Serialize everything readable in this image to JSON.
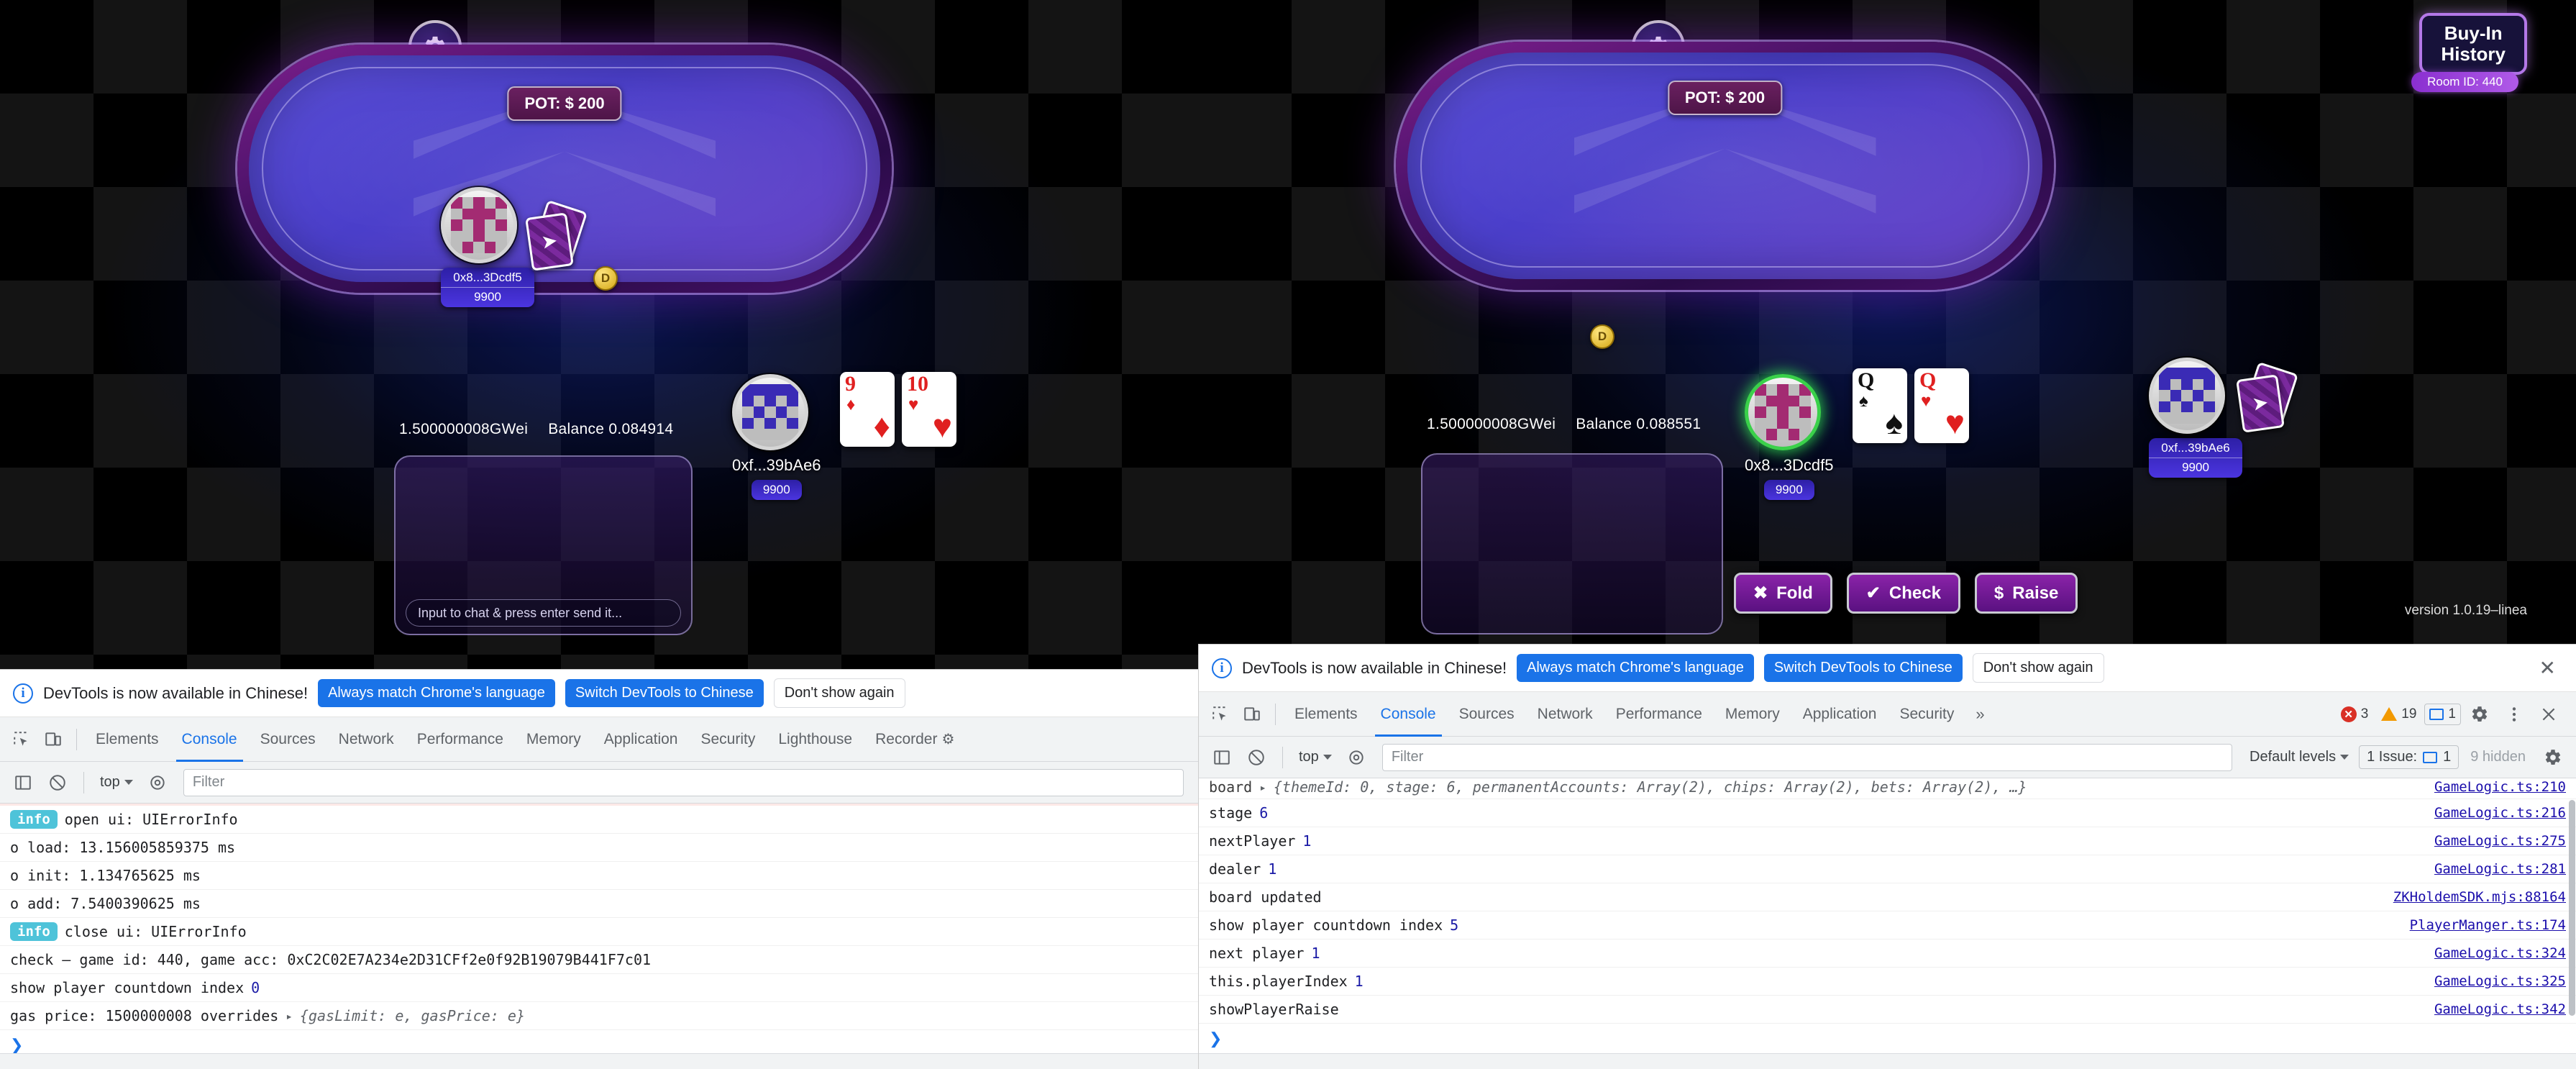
{
  "game_left": {
    "gear_icon": "gear-icon",
    "pot_label": "POT: $ 200",
    "gas_price": "1.500000008GWei",
    "balance": "Balance 0.084914",
    "chat_placeholder": "Input to chat & press enter send it...",
    "players": [
      {
        "id": "top-left",
        "name": "0x8...3Dcdf5",
        "chips": "9900",
        "cards_hidden": true,
        "active": false
      },
      {
        "id": "bottom",
        "name": "0xf...39bAe6",
        "chips": "9900",
        "cards_hidden": false,
        "active": false,
        "cards": [
          {
            "rank": "9",
            "suit": "♦",
            "color": "red"
          },
          {
            "rank": "10",
            "suit": "♥",
            "color": "red"
          }
        ]
      }
    ],
    "dealer_button": "D"
  },
  "game_right": {
    "gear_icon": "gear-icon",
    "pot_label": "POT: $ 200",
    "gas_price": "1.500000008GWei",
    "balance": "Balance 0.088551",
    "buyin_button": "Buy-In\nHistory",
    "buyin_line1": "Buy-In",
    "buyin_line2": "History",
    "room_id": "Room ID: 440",
    "version": "version 1.0.19–linea",
    "players": [
      {
        "id": "right-side",
        "name": "0xf...39bAe6",
        "chips": "9900",
        "cards_hidden": true,
        "active": false
      },
      {
        "id": "bottom",
        "name": "0x8...3Dcdf5",
        "chips": "9900",
        "cards_hidden": false,
        "active": true,
        "cards": [
          {
            "rank": "Q",
            "suit": "♠",
            "color": "black"
          },
          {
            "rank": "Q",
            "suit": "♥",
            "color": "red"
          }
        ]
      }
    ],
    "dealer_button": "D",
    "actions": [
      {
        "icon": "✖",
        "label": "Fold",
        "name": "fold-button"
      },
      {
        "icon": "✔",
        "label": "Check",
        "name": "check-button"
      },
      {
        "icon": "$",
        "label": "Raise",
        "name": "raise-button"
      }
    ]
  },
  "devtools_left": {
    "banner": {
      "message": "DevTools is now available in Chinese!",
      "btn_always": "Always match Chrome's language",
      "btn_switch": "Switch DevTools to Chinese",
      "btn_dismiss": "Don't show again"
    },
    "tabs": [
      "Elements",
      "Console",
      "Sources",
      "Network",
      "Performance",
      "Memory",
      "Application",
      "Security",
      "Lighthouse",
      "Recorder"
    ],
    "active_tab": "Console",
    "toolbar": {
      "context": "top",
      "filter_placeholder": "Filter"
    },
    "logs": [
      {
        "type": "info",
        "badge": "info",
        "text": "open ui: UIErrorInfo",
        "source": ""
      },
      {
        "type": "plain",
        "text": "o load: 13.156005859375 ms",
        "source": ""
      },
      {
        "type": "plain",
        "text": "o init: 1.134765625 ms",
        "source": ""
      },
      {
        "type": "plain",
        "text": "o add: 7.5400390625 ms",
        "source": ""
      },
      {
        "type": "info",
        "badge": "info",
        "text": "close ui: UIErrorInfo",
        "source": ""
      },
      {
        "type": "plain",
        "text": "check — game id: 440, game acc: 0xC2C02E7A234e2D31CFf2e0f92B19079B441F7c01",
        "source": ""
      },
      {
        "type": "num",
        "text": "show player countdown index ",
        "value": "0",
        "source": ""
      },
      {
        "type": "obj",
        "text": "gas price: 1500000008 overrides ",
        "object": "{gasLimit: e, gasPrice: e}",
        "source": ""
      }
    ]
  },
  "devtools_right": {
    "banner": {
      "message": "DevTools is now available in Chinese!",
      "btn_always": "Always match Chrome's language",
      "btn_switch": "Switch DevTools to Chinese",
      "btn_dismiss": "Don't show again"
    },
    "tabs": [
      "Elements",
      "Console",
      "Sources",
      "Network",
      "Performance",
      "Memory",
      "Application",
      "Security"
    ],
    "active_tab": "Console",
    "overflow": "»",
    "counters": {
      "errors": "3",
      "warnings": "19",
      "messages": "1"
    },
    "toolbar": {
      "context": "top",
      "filter_placeholder": "Filter",
      "levels": "Default levels",
      "issues": "1 Issue:",
      "issues_count": "1",
      "hidden": "9 hidden"
    },
    "logs": [
      {
        "text": "board ",
        "object": "{themeId: 0, stage: 6, permanentAccounts: Array(2), chips: Array(2), bets: Array(2), …}",
        "source": "GameLogic.ts:210",
        "clipped": true
      },
      {
        "text": "stage ",
        "value": "6",
        "source": "GameLogic.ts:216"
      },
      {
        "text": "nextPlayer ",
        "value": "1",
        "source": "GameLogic.ts:275"
      },
      {
        "text": "dealer ",
        "value": "1",
        "source": "GameLogic.ts:281"
      },
      {
        "text": "board updated",
        "value": "",
        "source": "ZKHoldemSDK.mjs:88164"
      },
      {
        "text": "show player countdown index ",
        "value": "5",
        "source": "PlayerManger.ts:174"
      },
      {
        "text": "next player ",
        "value": "1",
        "source": "GameLogic.ts:324"
      },
      {
        "text": "this.playerIndex ",
        "value": "1",
        "source": "GameLogic.ts:325"
      },
      {
        "text": "showPlayerRaise",
        "value": "",
        "source": "GameLogic.ts:342"
      }
    ]
  },
  "colors": {
    "accent_blue": "#1a73e8",
    "table_felt": "#5a4fd6",
    "table_rail": "#7d1f8e",
    "button_purple": "#8a23a8",
    "active_ring": "#3ad14a",
    "info_badge": "#4ec3d9",
    "error_red": "#d93025",
    "warn_orange": "#f29900"
  }
}
